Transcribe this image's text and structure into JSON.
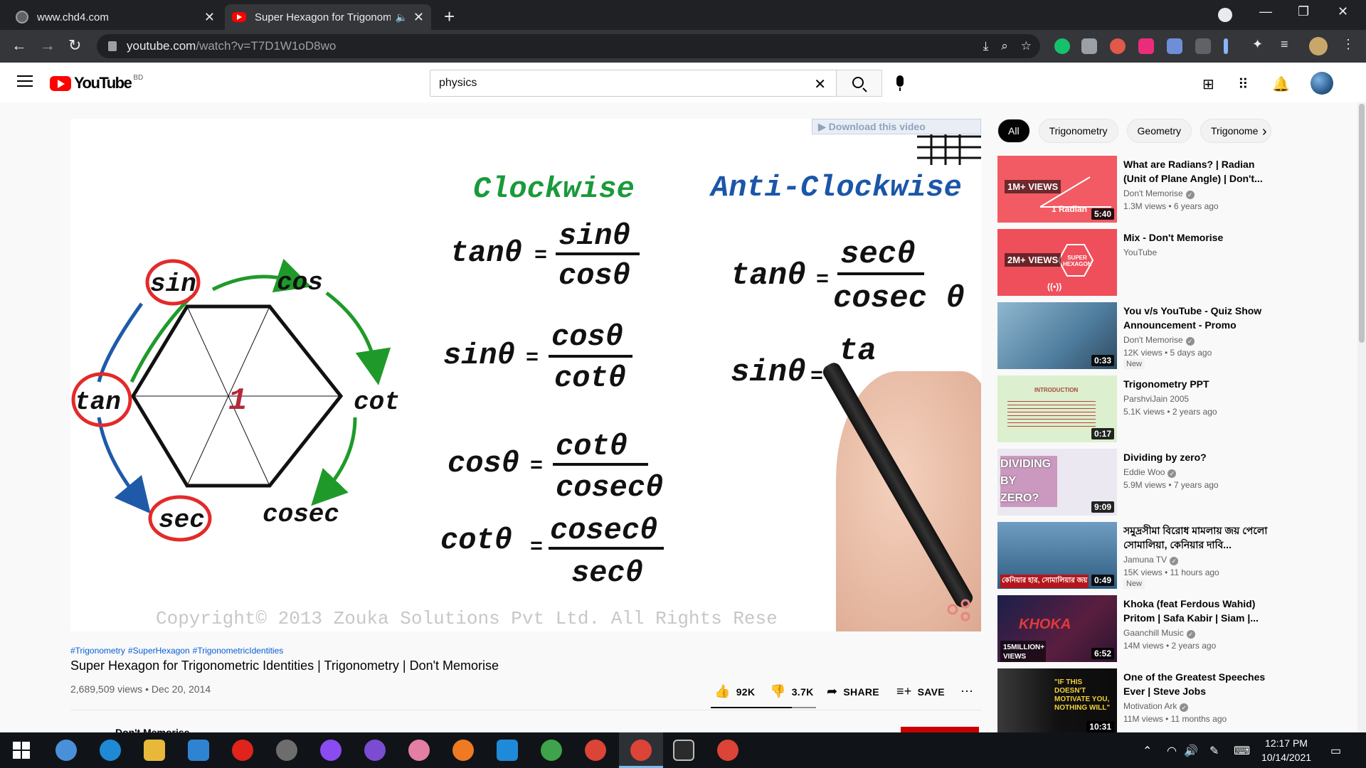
{
  "browser": {
    "tabs": [
      {
        "title": "www.chd4.com",
        "active": false,
        "favicon": "globe-icon"
      },
      {
        "title": "Super Hexagon for Trigonom",
        "active": true,
        "favicon": "youtube-icon",
        "audio": true
      }
    ],
    "url_host": "youtube.com",
    "url_path": "/watch?v=T7D1W1oD8wo"
  },
  "youtube": {
    "logo_text": "YouTube",
    "region": "BD",
    "search_value": "physics"
  },
  "video": {
    "download_banner": "Download this video",
    "copyright": "Copyright© 2013 Zouka Solutions Pvt Ltd. All Rights Rese",
    "hexagon": {
      "center": "1",
      "labels": {
        "sin": "sin",
        "cos": "cos",
        "cot": "cot",
        "cosec": "cosec",
        "sec": "sec",
        "tan": "tan"
      }
    },
    "headings": {
      "clockwise": "Clockwise",
      "anticlockwise": "Anti-Clockwise"
    },
    "clockwise": [
      {
        "lhs": "tanθ",
        "num": "sinθ",
        "den": "cosθ"
      },
      {
        "lhs": "sinθ",
        "num": "cosθ",
        "den": "cotθ"
      },
      {
        "lhs": "cosθ",
        "num": "cotθ",
        "den": "cosecθ"
      },
      {
        "lhs": "cotθ",
        "num": "cosecθ",
        "den": "secθ"
      }
    ],
    "anticlockwise": [
      {
        "lhs": "tanθ",
        "num": "secθ",
        "den": "cosec θ"
      },
      {
        "lhs": "sinθ",
        "partial": "ta"
      }
    ],
    "hashtags": [
      "#Trigonometry",
      "#SuperHexagon",
      "#TrigonometricIdentities"
    ],
    "title": "Super Hexagon for Trigonometric Identities | Trigonometry | Don't Memorise",
    "views": "2,689,509 views",
    "date": "Dec 20, 2014",
    "likes": "92K",
    "dislikes": "3.7K",
    "share_label": "SHARE",
    "save_label": "SAVE",
    "channel_peek": "Don't Memorise"
  },
  "chips": [
    "All",
    "Trigonometry",
    "Geometry",
    "Trigonome"
  ],
  "recommendations": [
    {
      "title": "What are Radians? | Radian (Unit of Plane Angle) | Don't...",
      "channel": "Don't Memorise",
      "verified": true,
      "meta": "1.3M views • 6 years ago",
      "duration": "5:40",
      "badge": "1M+ VIEWS",
      "thumb_text": "1 Radian",
      "color": "#f25b63"
    },
    {
      "title": "Mix - Don't Memorise",
      "channel": "YouTube",
      "verified": false,
      "meta": "",
      "duration": "",
      "badge": "2M+ VIEWS",
      "thumb_text": "SUPER HEXAGON",
      "color": "#ef4f5a"
    },
    {
      "title": "You v/s YouTube - Quiz Show Announcement - Promo",
      "channel": "Don't Memorise",
      "verified": true,
      "meta": "12K views • 5 days ago",
      "duration": "0:33",
      "new": "New",
      "color": "#5f8db0"
    },
    {
      "title": "Trigonometry PPT",
      "channel": "ParshviJain 2005",
      "verified": false,
      "meta": "5.1K views • 2 years ago",
      "duration": "0:17",
      "thumb_text": "INTRODUCTION",
      "color": "#d9edc9"
    },
    {
      "title": "Dividing by zero?",
      "channel": "Eddie Woo",
      "verified": true,
      "meta": "5.9M views • 7 years ago",
      "duration": "9:09",
      "thumb_text": "DIVIDING BY ZERO?",
      "color": "#e9e6ef"
    },
    {
      "title": "সমুদ্রসীমা বিরোধ মামলায় জয় পেলো সোমালিয়া, কেনিয়ার দাবি...",
      "channel": "Jamuna TV",
      "verified": true,
      "meta": "15K views • 11 hours ago",
      "duration": "0:49",
      "new": "New",
      "thumb_text": "কেনিয়ার হার, সোমালিয়ার জয়",
      "color": "#3d6f9a"
    },
    {
      "title": "Khoka (feat Ferdous Wahid) Pritom | Safa Kabir | Siam |...",
      "channel": "Gaanchill Music",
      "verified": true,
      "meta": "14M views • 2 years ago",
      "duration": "6:52",
      "badge": "15MILLION+ VIEWS",
      "thumb_text": "KHOKA",
      "color": "#3a1f3f"
    },
    {
      "title": "One of the Greatest Speeches Ever | Steve Jobs",
      "channel": "Motivation Ark",
      "verified": true,
      "meta": "11M views • 11 months ago",
      "duration": "10:31",
      "thumb_text": "\"IF THIS DOESN'T MOTIVATE YOU, NOTHING WILL\"",
      "color": "#1c1c1c"
    }
  ],
  "taskbar": {
    "time": "12:17 PM",
    "date": "10/14/2021"
  },
  "colors": {
    "red_circle": "#e32a2a",
    "green_arrow": "#1f9a2a",
    "blue_arrow": "#1f5aa8",
    "heading_green": "#1a9a3a",
    "heading_blue": "#1b56a8",
    "youtube_red": "#ff0000"
  }
}
